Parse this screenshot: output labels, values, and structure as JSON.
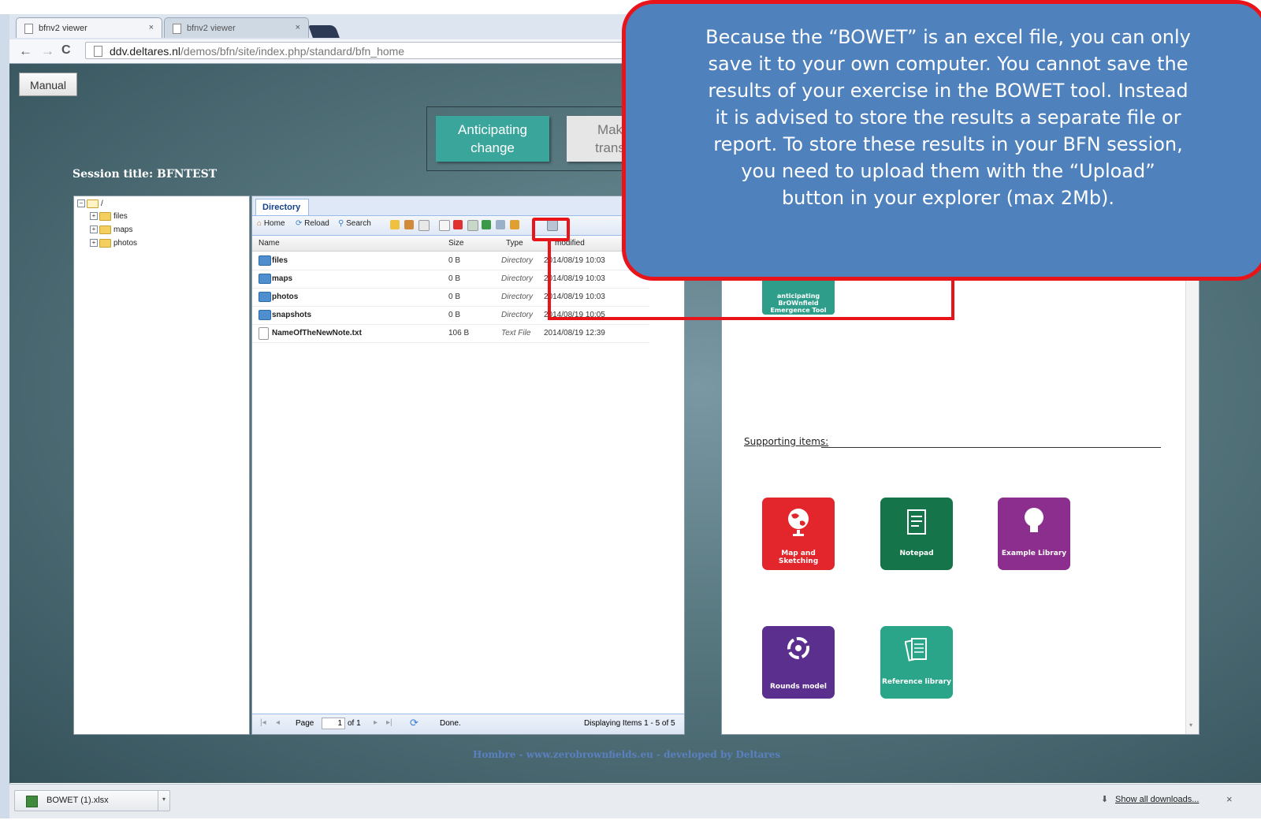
{
  "browser": {
    "tabs": [
      {
        "title": "bfnv2 viewer",
        "close": "×"
      },
      {
        "title": "bfnv2 viewer",
        "close": "×"
      }
    ],
    "nav": {
      "back": "←",
      "forward": "→",
      "reload": "C"
    },
    "url_host": "ddv.deltares.nl",
    "url_path": "/demos/bfn/site/index.php/standard/bfn_home"
  },
  "page": {
    "manual_label": "Manual",
    "anticipating_label": "Anticipating change",
    "making_label": "Mak\ntrans",
    "session_title": "Session title: BFNTEST",
    "footer_credit": "Hombre - www.zerobrownfields.eu - developed by Deltares"
  },
  "tree": {
    "root": "/",
    "items": [
      {
        "label": "files"
      },
      {
        "label": "maps"
      },
      {
        "label": "photos"
      }
    ]
  },
  "explorer": {
    "tab_label": "Directory",
    "toolbar": {
      "home": "Home",
      "reload": "Reload",
      "search": "Search"
    },
    "columns": {
      "name": "Name",
      "size": "Size",
      "type": "Type",
      "modified": "modified"
    },
    "rows": [
      {
        "name": "files",
        "size": "0 B",
        "type": "Directory",
        "modified": "2014/08/19 10:03",
        "kind": "dir"
      },
      {
        "name": "maps",
        "size": "0 B",
        "type": "Directory",
        "modified": "2014/08/19 10:03",
        "kind": "dir"
      },
      {
        "name": "photos",
        "size": "0 B",
        "type": "Directory",
        "modified": "2014/08/19 10:03",
        "kind": "dir"
      },
      {
        "name": "snapshots",
        "size": "0 B",
        "type": "Directory",
        "modified": "2014/08/19 10:05",
        "kind": "dir"
      },
      {
        "name": "NameOfTheNewNote.txt",
        "size": "106 B",
        "type": "Text File",
        "modified": "2014/08/19 12:39",
        "kind": "file"
      }
    ],
    "pager": {
      "page_label": "Page",
      "page_value": "1",
      "of_label": "of 1",
      "status": "Done.",
      "displaying": "Displaying Items 1 - 5 of 5"
    }
  },
  "right_panel": {
    "tool_label": "anticipating BrOWnfield Emergence Tool",
    "supporting_label": "Supporting items:",
    "apps": [
      {
        "label": "Map and Sketching",
        "color": "#e3262b",
        "icon": "globe-icon"
      },
      {
        "label": "Notepad",
        "color": "#15744a",
        "icon": "notepad-icon"
      },
      {
        "label": "Example Library",
        "color": "#8b2e8e",
        "icon": "lightbulb-icon"
      },
      {
        "label": "Rounds model",
        "color": "#5a2f8e",
        "icon": "cycle-icon"
      },
      {
        "label": "Reference library",
        "color": "#2aa58a",
        "icon": "documents-icon"
      }
    ]
  },
  "callout": {
    "text": "Because the “BOWET” is an excel file, you can only\nsave it to your own computer. You cannot save the\nresults of your exercise in the BOWET tool. Instead\nit is advised to store the results a separate file or\nreport. To store these results in your BFN session,\nyou need to upload them with the “Upload”\nbutton in your explorer (max 2Mb)."
  },
  "downloads": {
    "file": "BOWET (1).xlsx",
    "show_all": "Show all downloads...",
    "close": "×"
  },
  "colors": {
    "highlight": "#e8141a",
    "callout_fill": "#4f81bd",
    "accent_teal": "#3aa59b"
  }
}
